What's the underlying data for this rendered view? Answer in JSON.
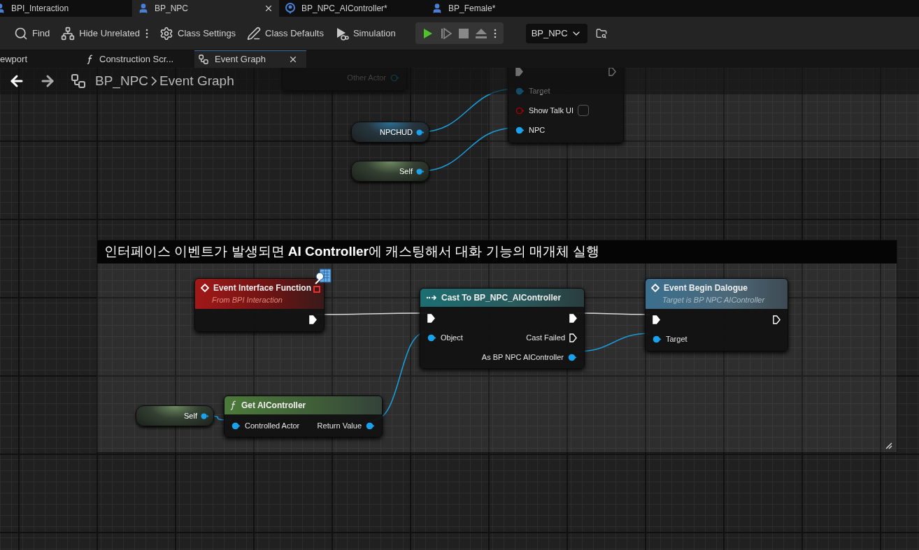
{
  "document_tabs": [
    {
      "label": "BPI_Interaction",
      "kind": "interface",
      "selected": false,
      "closable": false
    },
    {
      "label": "BP_NPC",
      "kind": "actor",
      "selected": true,
      "closable": true
    },
    {
      "label": "BP_NPC_AIController*",
      "kind": "controller",
      "selected": false,
      "closable": false
    },
    {
      "label": "BP_Female*",
      "kind": "actor",
      "selected": false,
      "closable": false
    }
  ],
  "toolbar": {
    "buttons": [
      {
        "label": "Find",
        "kind": "find",
        "more": false
      },
      {
        "label": "Hide Unrelated",
        "kind": "hide",
        "more": true
      },
      {
        "label": "Class Settings",
        "kind": "settings",
        "more": false
      },
      {
        "label": "Class Defaults",
        "kind": "defaults",
        "more": false
      },
      {
        "label": "Simulation",
        "kind": "simulation",
        "more": false
      }
    ],
    "debug_object": "BP_NPC"
  },
  "graph_tabs": [
    {
      "label": "ewport",
      "kind": "viewport",
      "selected": false,
      "closable": false
    },
    {
      "label": "Construction Scr...",
      "kind": "function",
      "selected": false,
      "closable": false
    },
    {
      "label": "Event Graph",
      "kind": "graph",
      "selected": true,
      "closable": true
    }
  ],
  "breadcrumb": [
    "BP_NPC",
    "Event Graph"
  ],
  "comment": "인터페이스 이벤트가 발생되면 **AI Controller**에 캐스팅해서 대화 기능의 매개체 실행",
  "nodes": [
    {
      "kind": "partial",
      "rows": [
        {
          "right": {
            "label": "Other Actor",
            "kind": "object",
            "connected": false
          }
        }
      ]
    },
    {
      "kind": "variable",
      "label": "NPCHUD"
    },
    {
      "kind": "self",
      "label": "Self"
    },
    {
      "kind": "partial",
      "rows": [
        {
          "left": {
            "kind": "exec",
            "connected": true
          },
          "right": {
            "kind": "exec",
            "connected": false
          }
        },
        {
          "left": {
            "label": "Target",
            "kind": "object",
            "connected": true
          }
        },
        {
          "left": {
            "label": "Show Talk UI",
            "kind": "bool",
            "connected": false,
            "checked": false
          }
        },
        {
          "left": {
            "label": "NPC",
            "kind": "object",
            "connected": true
          }
        }
      ]
    },
    {
      "kind": "event",
      "title": "Event Interface Function",
      "subtitle": "From BPI Interaction",
      "rows": [
        {
          "right": {
            "kind": "exec",
            "connected": true
          }
        }
      ]
    },
    {
      "kind": "cast",
      "title": "Cast To BP_NPC_AIController",
      "rows": [
        {
          "left": {
            "kind": "exec",
            "connected": true
          },
          "right": {
            "kind": "exec",
            "connected": true
          }
        },
        {
          "left": {
            "label": "Object",
            "kind": "object",
            "connected": true
          },
          "right": {
            "label": "Cast Failed",
            "kind": "exec",
            "connected": false
          }
        },
        {
          "right": {
            "label": "As BP NPC AIController",
            "kind": "object",
            "connected": true
          }
        }
      ]
    },
    {
      "kind": "call",
      "title": "Event Begin Dalogue",
      "subtitle": "Target is BP NPC AIController",
      "rows": [
        {
          "left": {
            "kind": "exec",
            "connected": true
          },
          "right": {
            "kind": "exec",
            "connected": false
          }
        },
        {
          "left": {
            "label": "Target",
            "kind": "object",
            "connected": true
          }
        }
      ]
    },
    {
      "kind": "self",
      "label": "Self"
    },
    {
      "kind": "function",
      "title": "Get AIController",
      "rows": [
        {
          "left": {
            "label": "Controlled Actor",
            "kind": "object",
            "connected": true
          },
          "right": {
            "label": "Return Value",
            "kind": "object",
            "connected": true
          }
        }
      ]
    }
  ]
}
